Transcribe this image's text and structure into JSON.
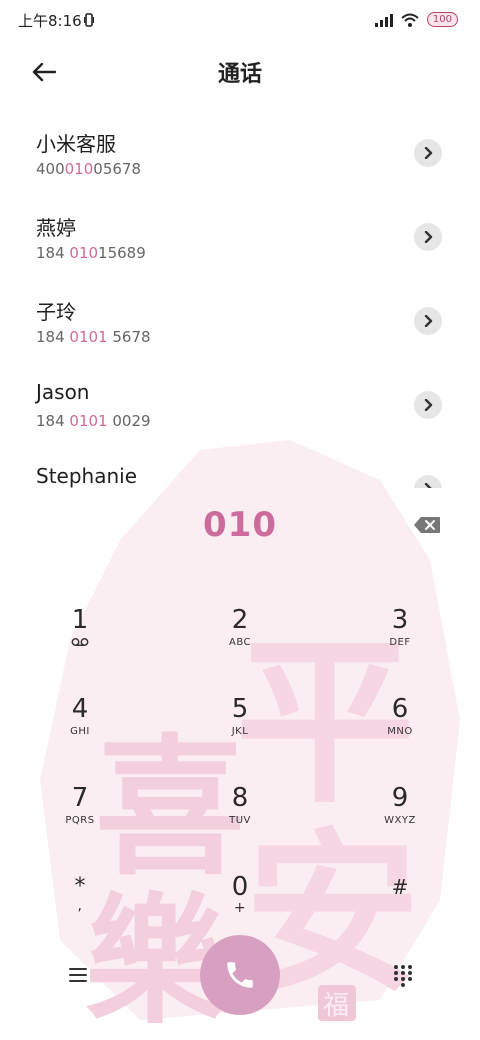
{
  "status_bar": {
    "time": "上午8:16",
    "battery": "100"
  },
  "header": {
    "title": "通话"
  },
  "contacts": [
    {
      "name": "小米客服",
      "number_pre": "400",
      "number_match": "010",
      "number_post": "05678"
    },
    {
      "name": "燕婷",
      "number_pre": "184 ",
      "number_match": "010",
      "number_post": "15689"
    },
    {
      "name": "子玲",
      "number_pre": "184 ",
      "number_match": "0101",
      "number_post": " 5678"
    },
    {
      "name": "Jason",
      "number_pre": "184 ",
      "number_match": "0101",
      "number_post": " 0029"
    },
    {
      "name": "Stephanie",
      "number_pre": "",
      "number_match": "",
      "number_post": ""
    }
  ],
  "dialer": {
    "input": "010",
    "keys": [
      {
        "digit": "1",
        "letters": ""
      },
      {
        "digit": "2",
        "letters": "ABC"
      },
      {
        "digit": "3",
        "letters": "DEF"
      },
      {
        "digit": "4",
        "letters": "GHI"
      },
      {
        "digit": "5",
        "letters": "JKL"
      },
      {
        "digit": "6",
        "letters": "MNO"
      },
      {
        "digit": "7",
        "letters": "PQRS"
      },
      {
        "digit": "8",
        "letters": "TUV"
      },
      {
        "digit": "9",
        "letters": "WXYZ"
      },
      {
        "digit": "*",
        "letters": ","
      },
      {
        "digit": "0",
        "letters": "+"
      },
      {
        "digit": "#",
        "letters": ""
      }
    ]
  },
  "background_art": {
    "chars": [
      "平",
      "安",
      "喜",
      "樂"
    ],
    "seal": "福"
  },
  "colors": {
    "accent": "#cc6c9c",
    "highlight": "#d2699a",
    "call_button": "#d8a0c0",
    "art": "#f5d6e2"
  },
  "icons": {
    "back": "arrow-left-icon",
    "chevron": "chevron-right-icon",
    "backspace": "backspace-icon",
    "menu": "menu-icon",
    "call": "phone-icon",
    "dialpad": "dialpad-icon",
    "voicemail": "voicemail-icon"
  }
}
